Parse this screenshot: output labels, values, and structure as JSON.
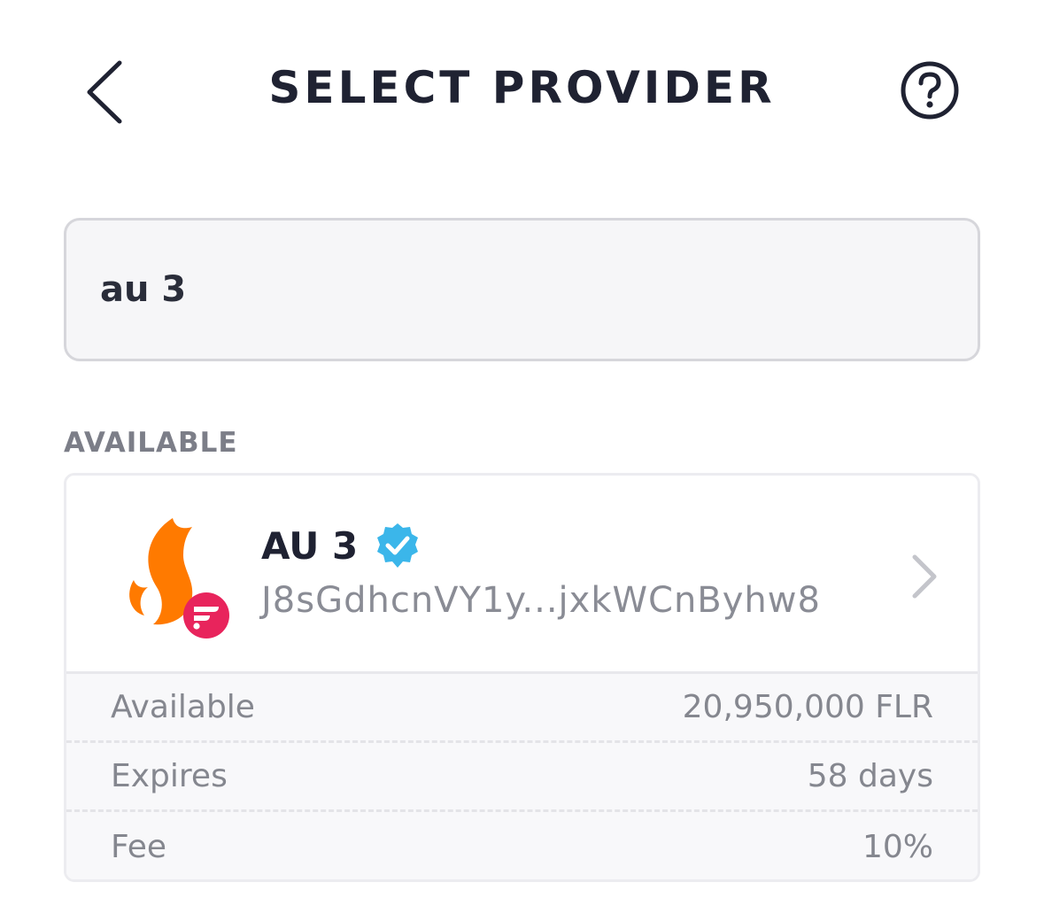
{
  "header": {
    "title": "SELECT PROVIDER"
  },
  "search": {
    "value": "au 3"
  },
  "section": {
    "label": "AVAILABLE"
  },
  "provider": {
    "name": "AU 3",
    "address": "J8sGdhcnVY1y...jxkWCnByhw8",
    "details": [
      {
        "label": "Available",
        "value": "20,950,000 FLR"
      },
      {
        "label": "Expires",
        "value": "58 days"
      },
      {
        "label": "Fee",
        "value": "10%"
      }
    ]
  },
  "icons": {
    "back": "chevron-left-icon",
    "help": "question-circle-icon",
    "logo": "flame-logo-icon",
    "verified": "verified-badge-icon",
    "chevron": "chevron-right-icon"
  },
  "colors": {
    "flame": "#ff7a00",
    "flare_badge": "#e8245c",
    "verified": "#3bb6ea"
  }
}
